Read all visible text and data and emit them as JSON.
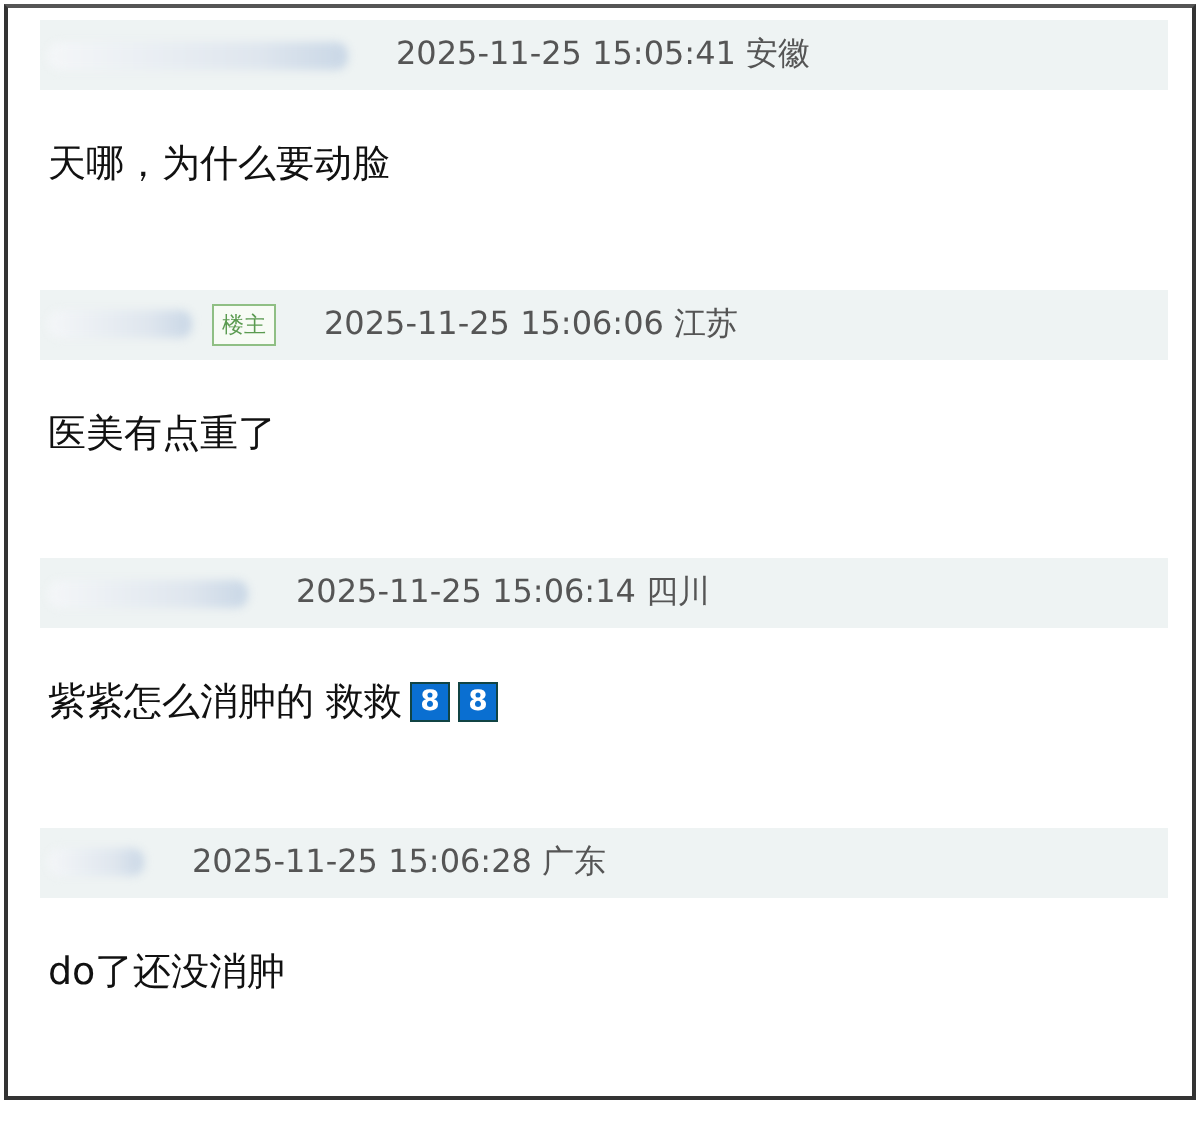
{
  "comments": [
    {
      "timestamp": "2025-11-25 15:05:41",
      "location": "安徽",
      "body": [
        {
          "kind": "text",
          "text": "天哪，为什么要动脸"
        }
      ]
    },
    {
      "badge": "楼主",
      "timestamp": "2025-11-25 15:06:06",
      "location": "江苏",
      "body": [
        {
          "kind": "text",
          "text": "医美有点重了"
        }
      ]
    },
    {
      "timestamp": "2025-11-25 15:06:14",
      "location": "四川",
      "body": [
        {
          "kind": "text",
          "text": "紫紫怎么消肿的 救救"
        },
        {
          "kind": "keycap",
          "text": "8"
        },
        {
          "kind": "keycap",
          "text": "8"
        }
      ]
    },
    {
      "timestamp": "2025-11-25 15:06:28",
      "location": "广东",
      "body": [
        {
          "kind": "text",
          "text": "do了还没消肿"
        }
      ]
    }
  ]
}
